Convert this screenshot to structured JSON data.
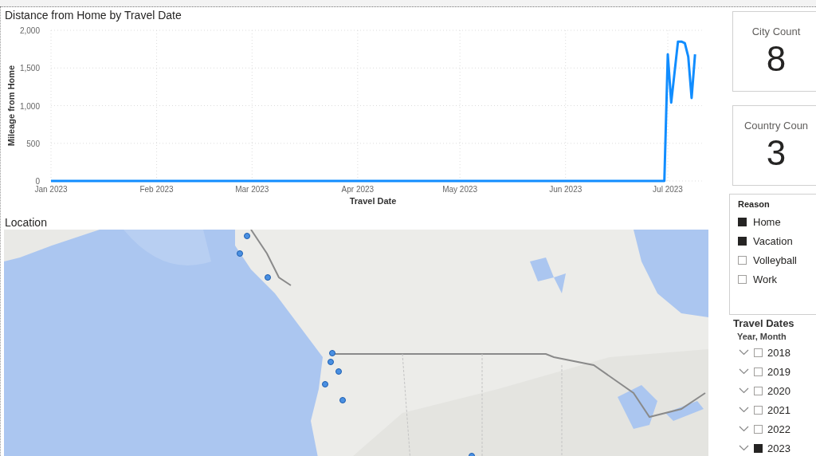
{
  "line_chart": {
    "title": "Distance from Home by Travel Date",
    "chart_data": {
      "type": "line",
      "xlabel": "Travel Date",
      "ylabel": "Mileage from Home",
      "x": [
        "2023-01-01",
        "2023-06-30",
        "2023-07-01",
        "2023-07-02",
        "2023-07-04",
        "2023-07-05",
        "2023-07-06",
        "2023-07-07",
        "2023-07-08",
        "2023-07-09"
      ],
      "series": [
        {
          "color": "#118dff",
          "values": [
            0,
            0,
            1680,
            1040,
            1850,
            1850,
            1830,
            1650,
            1100,
            1680
          ]
        }
      ],
      "grid": true,
      "xlim": [
        "2023-01-01",
        "2023-07-11"
      ],
      "ylim": [
        0,
        2000
      ],
      "xticks": [
        {
          "value": "2023-01-01",
          "label": "Jan 2023"
        },
        {
          "value": "2023-02-01",
          "label": "Feb 2023"
        },
        {
          "value": "2023-03-01",
          "label": "Mar 2023"
        },
        {
          "value": "2023-04-01",
          "label": "Apr 2023"
        },
        {
          "value": "2023-05-01",
          "label": "May 2023"
        },
        {
          "value": "2023-06-01",
          "label": "Jun 2023"
        },
        {
          "value": "2023-07-01",
          "label": "Jul 2023"
        }
      ],
      "yticks": [
        {
          "value": 0,
          "label": "0"
        },
        {
          "value": 500,
          "label": "500"
        },
        {
          "value": 1000,
          "label": "1,000"
        },
        {
          "value": 1500,
          "label": "1,500"
        },
        {
          "value": 2000,
          "label": "2,000"
        }
      ]
    }
  },
  "map": {
    "title": "Location",
    "kind": "picture"
  },
  "cards": [
    {
      "label": "City Count",
      "value": "8"
    },
    {
      "label": "Country Coun",
      "value": "3"
    }
  ],
  "reason_slicer": {
    "title": "Reason",
    "items": [
      {
        "label": "Home",
        "checked": true
      },
      {
        "label": "Vacation",
        "checked": true
      },
      {
        "label": "Volleyball",
        "checked": false
      },
      {
        "label": "Work",
        "checked": false
      }
    ]
  },
  "date_slicer": {
    "title": "Travel Dates",
    "subtitle": "Year, Month",
    "items": [
      {
        "label": "2018",
        "checked": false
      },
      {
        "label": "2019",
        "checked": false
      },
      {
        "label": "2020",
        "checked": false
      },
      {
        "label": "2021",
        "checked": false
      },
      {
        "label": "2022",
        "checked": false
      },
      {
        "label": "2023",
        "checked": true
      }
    ]
  }
}
